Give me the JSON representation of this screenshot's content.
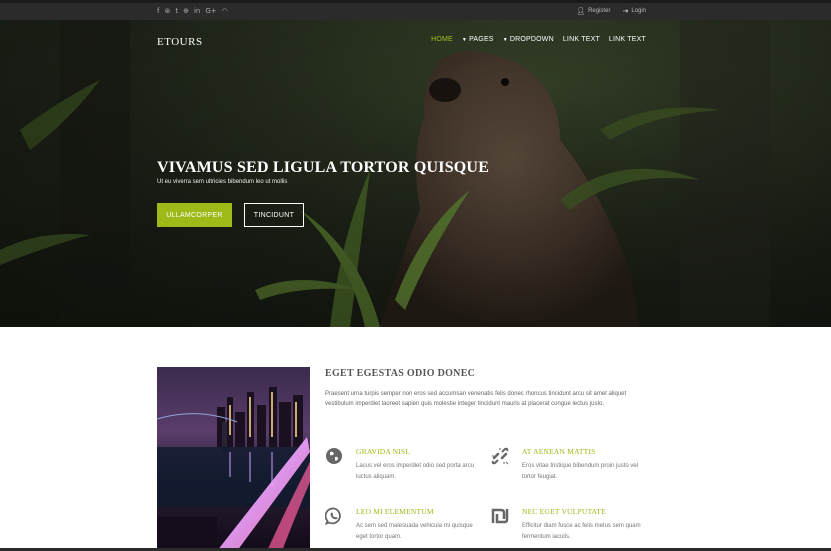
{
  "topbar": {
    "social_icons": [
      "facebook-icon",
      "pinterest-icon",
      "twitter-icon",
      "dribbble-icon",
      "linkedin-icon",
      "google-plus-icon",
      "rss-icon"
    ],
    "social_glyphs": [
      "f",
      "⊛",
      "t",
      "⊕",
      "in",
      "G+",
      "◠"
    ],
    "register_label": "Register",
    "login_label": "Login"
  },
  "header": {
    "logo": "ETOURS",
    "nav": [
      {
        "label": "HOME",
        "active": true,
        "dropdown": false
      },
      {
        "label": "PAGES",
        "active": false,
        "dropdown": true
      },
      {
        "label": "DROPDOWN",
        "active": false,
        "dropdown": true
      },
      {
        "label": "LINK TEXT",
        "active": false,
        "dropdown": false
      },
      {
        "label": "LINK TEXT",
        "active": false,
        "dropdown": false
      }
    ]
  },
  "hero": {
    "title": "VIVAMUS SED LIGULA TORTOR QUISQUE",
    "subtitle": "Ut eu viverra sem ultricies bibendum leo ut mollis",
    "primary_button": "ULLAMCORPER",
    "secondary_button": "TINCIDUNT"
  },
  "about": {
    "title": "EGET EGESTAS ODIO DONEC",
    "paragraph": "Praesent urna turpis semper non eros sed accumsan venenatis felis donec rhoncus tincidunt arcu sit amet aliquet vestibulum imperdiet laoreet sapien quis molestie integer tincidunt mauris at placerat congue lectus justo.",
    "features": [
      {
        "icon": "globe-icon",
        "title": "GRAVIDA NISL",
        "text": "Lacus vel eros imperdiet odio sed porta arcu luctus aliquam."
      },
      {
        "icon": "broken-link-icon",
        "title": "AT AENEAN MATTIS",
        "text": "Eros vitae tristique bibendum proin justo vel tortor feugiat."
      },
      {
        "icon": "whatsapp-icon",
        "title": "LEO MI ELEMENTUM",
        "text": "Ac sem sed malesuada vehicula mi quisque eget tortor quam."
      },
      {
        "icon": "shekel-icon",
        "title": "NEC EGET VULPUTATE",
        "text": "Efficitur diam fusce ac felis metus sem quam fermentum iaculis."
      }
    ]
  },
  "colors": {
    "accent": "#9cba18",
    "topbar": "#2b2b2b"
  }
}
